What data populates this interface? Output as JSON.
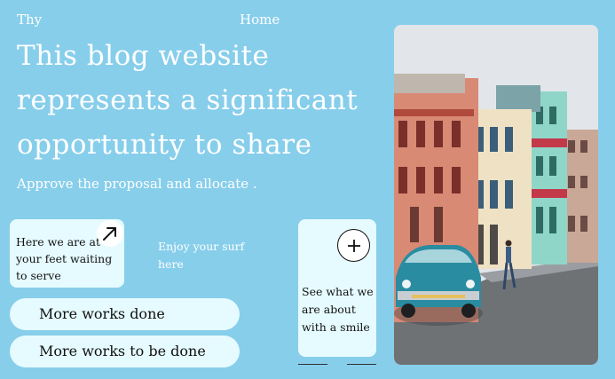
{
  "header": {
    "brand": "Thy",
    "nav_home": "Home"
  },
  "hero": {
    "title": "This blog website represents a significant opportunity to share",
    "subtitle": "Approve the proposal and allocate ."
  },
  "card_small": {
    "text": "Here we are at your feet waiting to serve",
    "icon": "arrow-up-right-icon"
  },
  "side_note": {
    "text": "Enjoy your surf here"
  },
  "buttons": {
    "more_works_done": "More works done",
    "more_works_to_be_done": "More works to be done"
  },
  "card_tall": {
    "text": "See what we are about with a smile",
    "icon": "plus-icon"
  },
  "colors": {
    "background": "#87ceeb",
    "card": "#e6fbff",
    "text_light": "#ffffff",
    "text_dark": "#111111"
  }
}
